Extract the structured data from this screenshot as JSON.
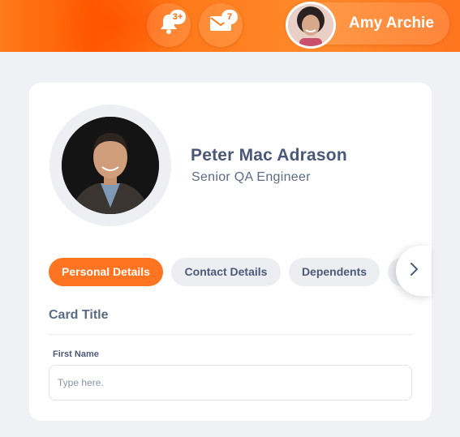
{
  "header": {
    "notifications": {
      "icon": "bell-icon",
      "count": "3+"
    },
    "messages": {
      "icon": "mail-icon",
      "count": "7"
    },
    "user": {
      "name": "Amy Archie"
    }
  },
  "profile": {
    "name": "Peter Mac Adrason",
    "title": "Senior QA Engineer"
  },
  "tabs": [
    {
      "label": "Personal Details",
      "active": true
    },
    {
      "label": "Contact Details",
      "active": false
    },
    {
      "label": "Dependents",
      "active": false
    }
  ],
  "form": {
    "card_title": "Card Title",
    "first_name": {
      "label": "First Name",
      "placeholder": "Type here.",
      "value": ""
    }
  },
  "colors": {
    "accent": "#ff7420",
    "text_primary": "#4a5878",
    "tab_inactive": "#eceef2"
  }
}
